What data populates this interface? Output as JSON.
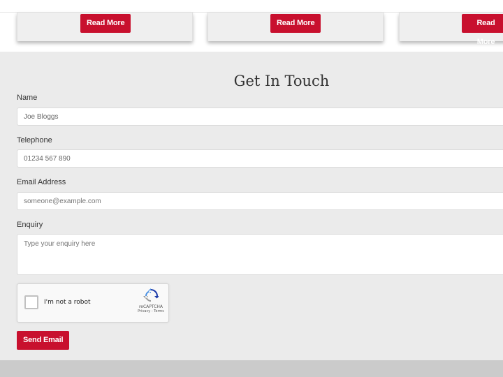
{
  "cards": [
    {
      "button_label": "Read More"
    },
    {
      "button_label": "Read More"
    },
    {
      "button_label": "Read More"
    }
  ],
  "contact": {
    "heading": "Get In Touch",
    "fields": {
      "name": {
        "label": "Name",
        "value": "Joe Bloggs"
      },
      "telephone": {
        "label": "Telephone",
        "value": "01234 567 890"
      },
      "email": {
        "label": "Email Address",
        "placeholder": "someone@example.com"
      },
      "enquiry": {
        "label": "Enquiry",
        "placeholder": "Type your enquiry here"
      }
    },
    "captcha": {
      "label": "I'm not a robot",
      "brand": "reCAPTCHA",
      "links": "Privacy - Terms"
    },
    "submit_label": "Send Email"
  },
  "colors": {
    "accent": "#c8102e",
    "section_bg": "#ebebeb",
    "footer_bg": "#cbcbcb"
  }
}
